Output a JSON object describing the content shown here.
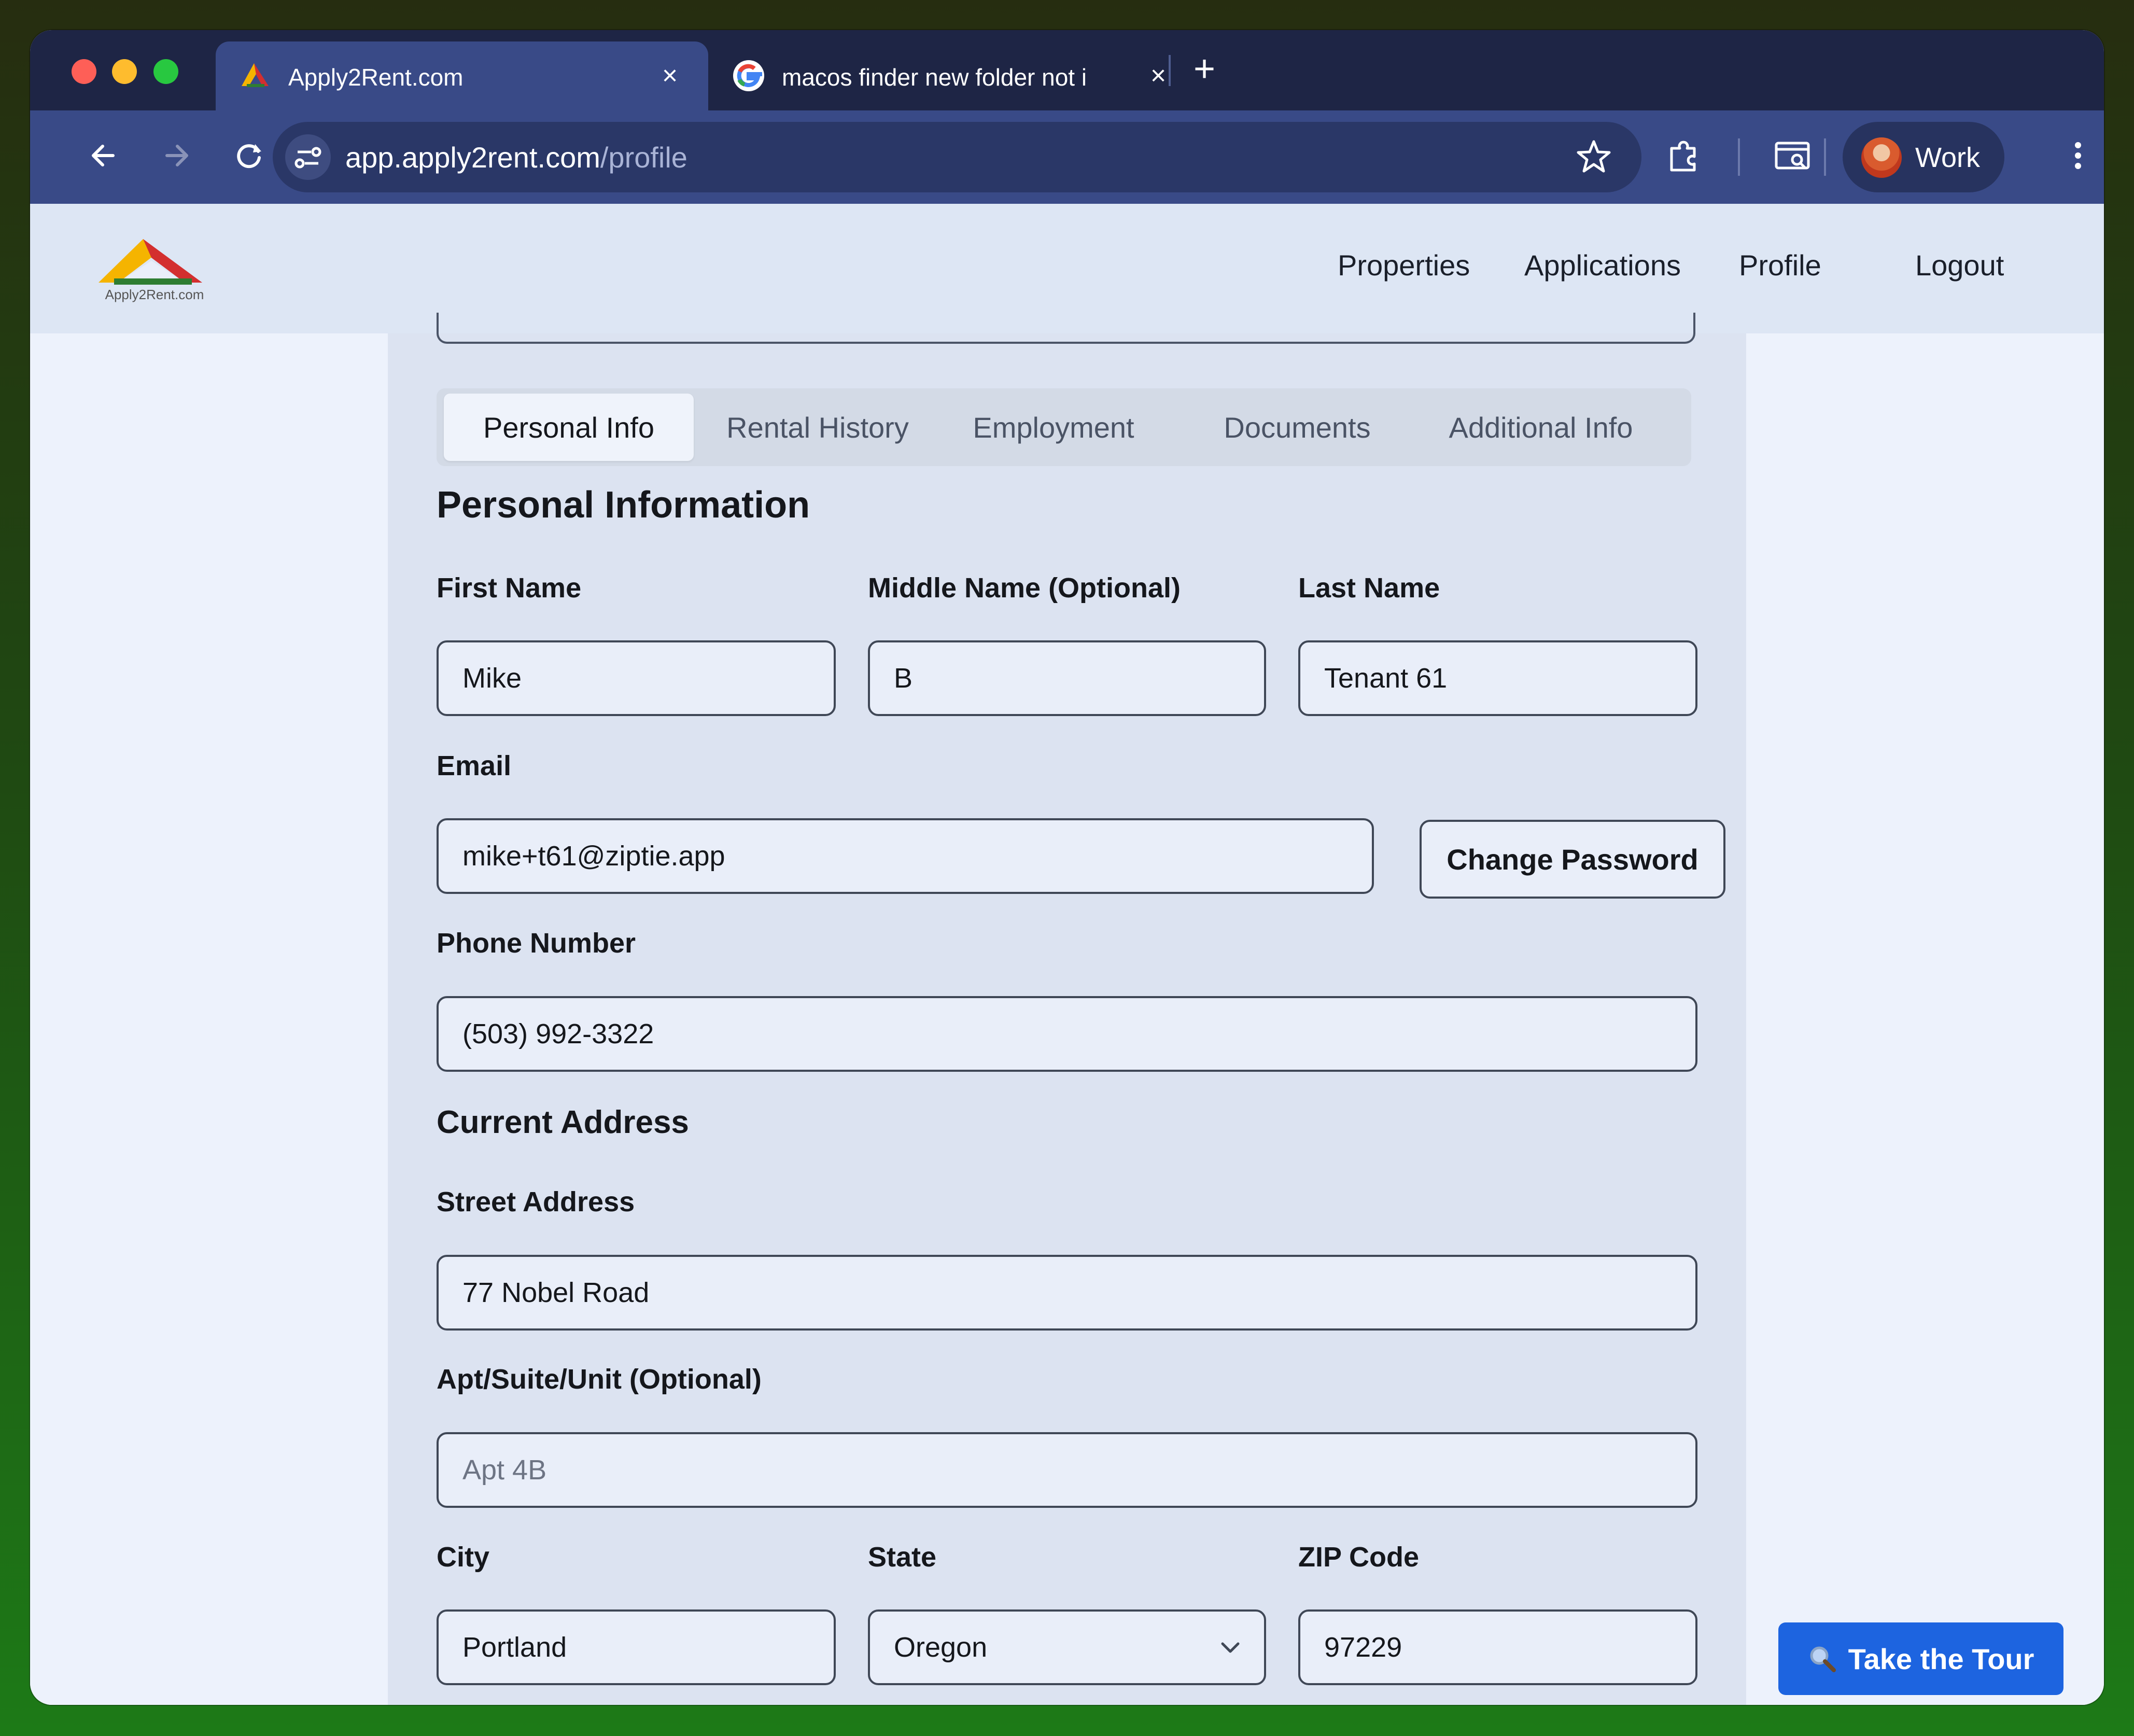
{
  "browser": {
    "tabs": [
      {
        "title": "Apply2Rent.com",
        "active": true,
        "icon": "apply2rent-logo-icon"
      },
      {
        "title": "macos finder new folder not i",
        "active": false,
        "icon": "google-icon"
      }
    ],
    "url_host": "app.apply2rent.com",
    "url_path": "/profile",
    "profile_label": "Work"
  },
  "navbar": {
    "logo_text": "Apply2Rent.com",
    "items": [
      "Properties",
      "Applications",
      "Profile",
      "Logout"
    ]
  },
  "profile_tabs": [
    "Personal Info",
    "Rental History",
    "Employment",
    "Documents",
    "Additional Info"
  ],
  "active_tab": "Personal Info",
  "personal": {
    "section_title": "Personal Information",
    "first_name": {
      "label": "First Name",
      "value": "Mike"
    },
    "middle_name": {
      "label": "Middle Name (Optional)",
      "value": "B"
    },
    "last_name": {
      "label": "Last Name",
      "value": "Tenant 61"
    },
    "email": {
      "label": "Email",
      "value": "mike+t61@ziptie.app"
    },
    "change_password": "Change Password",
    "phone": {
      "label": "Phone Number",
      "value": "(503) 992-3322"
    }
  },
  "address": {
    "section_title": "Current Address",
    "street": {
      "label": "Street Address",
      "value": "77 Nobel Road"
    },
    "apt": {
      "label": "Apt/Suite/Unit (Optional)",
      "placeholder": "Apt 4B"
    },
    "city": {
      "label": "City",
      "value": "Portland"
    },
    "state": {
      "label": "State",
      "value": "Oregon"
    },
    "zip": {
      "label": "ZIP Code",
      "value": "97229"
    }
  },
  "tour_button": "Take the Tour",
  "colors": {
    "accent": "#1d64e0",
    "nav_bg": "#dde6f4",
    "chrome": "#394a87"
  }
}
